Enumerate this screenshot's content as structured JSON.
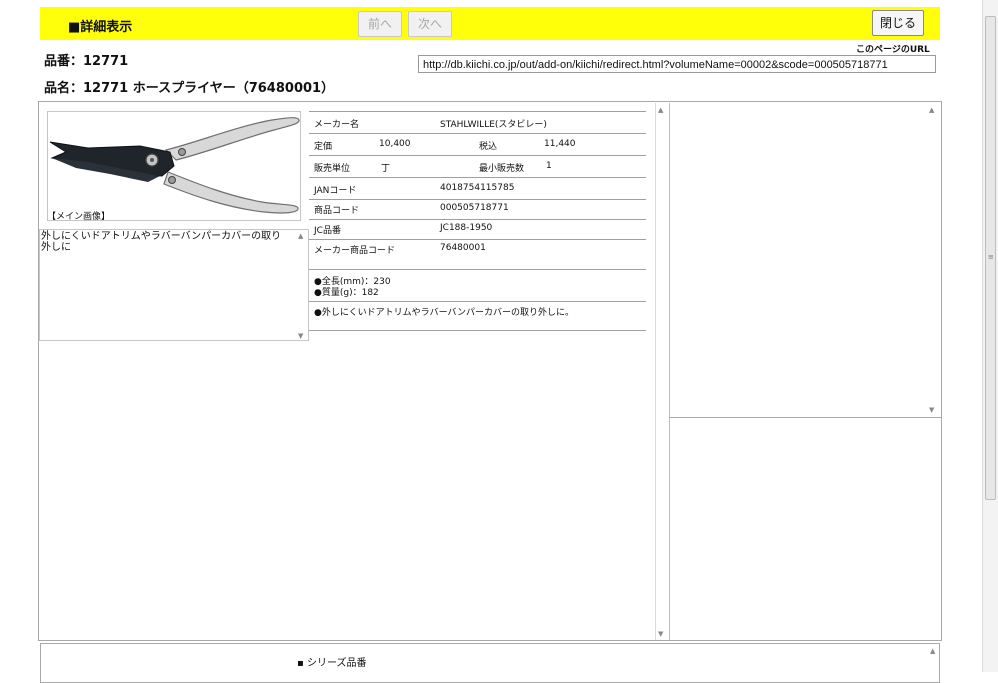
{
  "header": {
    "title": "■詳細表示",
    "prev_label": "前へ",
    "next_label": "次へ",
    "close_label": "閉じる"
  },
  "product": {
    "part_number": "品番：12771",
    "part_name": "品名：12771 ホースプライヤー（76480001）"
  },
  "url": {
    "label": "このページのURL",
    "value": "http://db.kiichi.co.jp/out/add-on/kiichi/redirect.html?volumeName=00002&scode=000505718771"
  },
  "image": {
    "caption": "【メイン画像】",
    "description": "外しにくいドアトリムやラバーバンパーカバーの取り外しに"
  },
  "info": {
    "maker_label": "メーカー名",
    "maker_value": "STAHLWILLE(スタビレー)",
    "list_price_label": "定価",
    "list_price_value": "10,400",
    "tax_incl_label": "税込",
    "tax_incl_value": "11,440",
    "sales_unit_label": "販売単位",
    "sales_unit_value": "丁",
    "min_qty_label": "最小販売数",
    "min_qty_value": "1",
    "jan_label": "JANコード",
    "jan_value": "4018754115785",
    "product_code_label": "商品コード",
    "product_code_value": "000505718771",
    "jc_label": "JC品番",
    "jc_value": "JC188-1950",
    "maker_code_label": "メーカー商品コード",
    "maker_code_value": "76480001",
    "spec_1": "●全長(mm)：230",
    "spec_2": "●質量(g)：182",
    "feature": "●外しにくいドアトリムやラバーバンパーカバーの取り外しに。"
  },
  "series": {
    "label": "シリーズ品番"
  },
  "colors": {
    "header_bg": "#ffff0a",
    "border": "#a9a9a9"
  }
}
